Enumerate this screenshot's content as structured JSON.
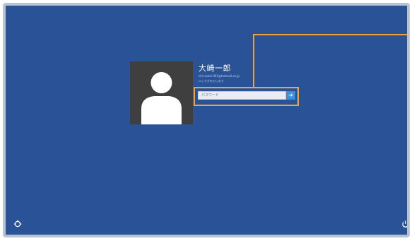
{
  "user": {
    "name": "大崎一郎",
    "email": "ichi-osaki-001@hotmail.co.jp",
    "status": "ロックされています",
    "avatar_icon": "user-silhouette-icon"
  },
  "password": {
    "placeholder": "パスワード",
    "value": "",
    "submit_icon": "arrow-right-icon"
  },
  "bottom_bar": {
    "ease_of_access_icon": "ease-of-access-icon",
    "power_icon": "power-icon"
  },
  "colors": {
    "background": "#2a5296",
    "highlight": "#f0a33a",
    "submit": "#3c8fd8",
    "avatar_bg": "#3f3f3f"
  }
}
